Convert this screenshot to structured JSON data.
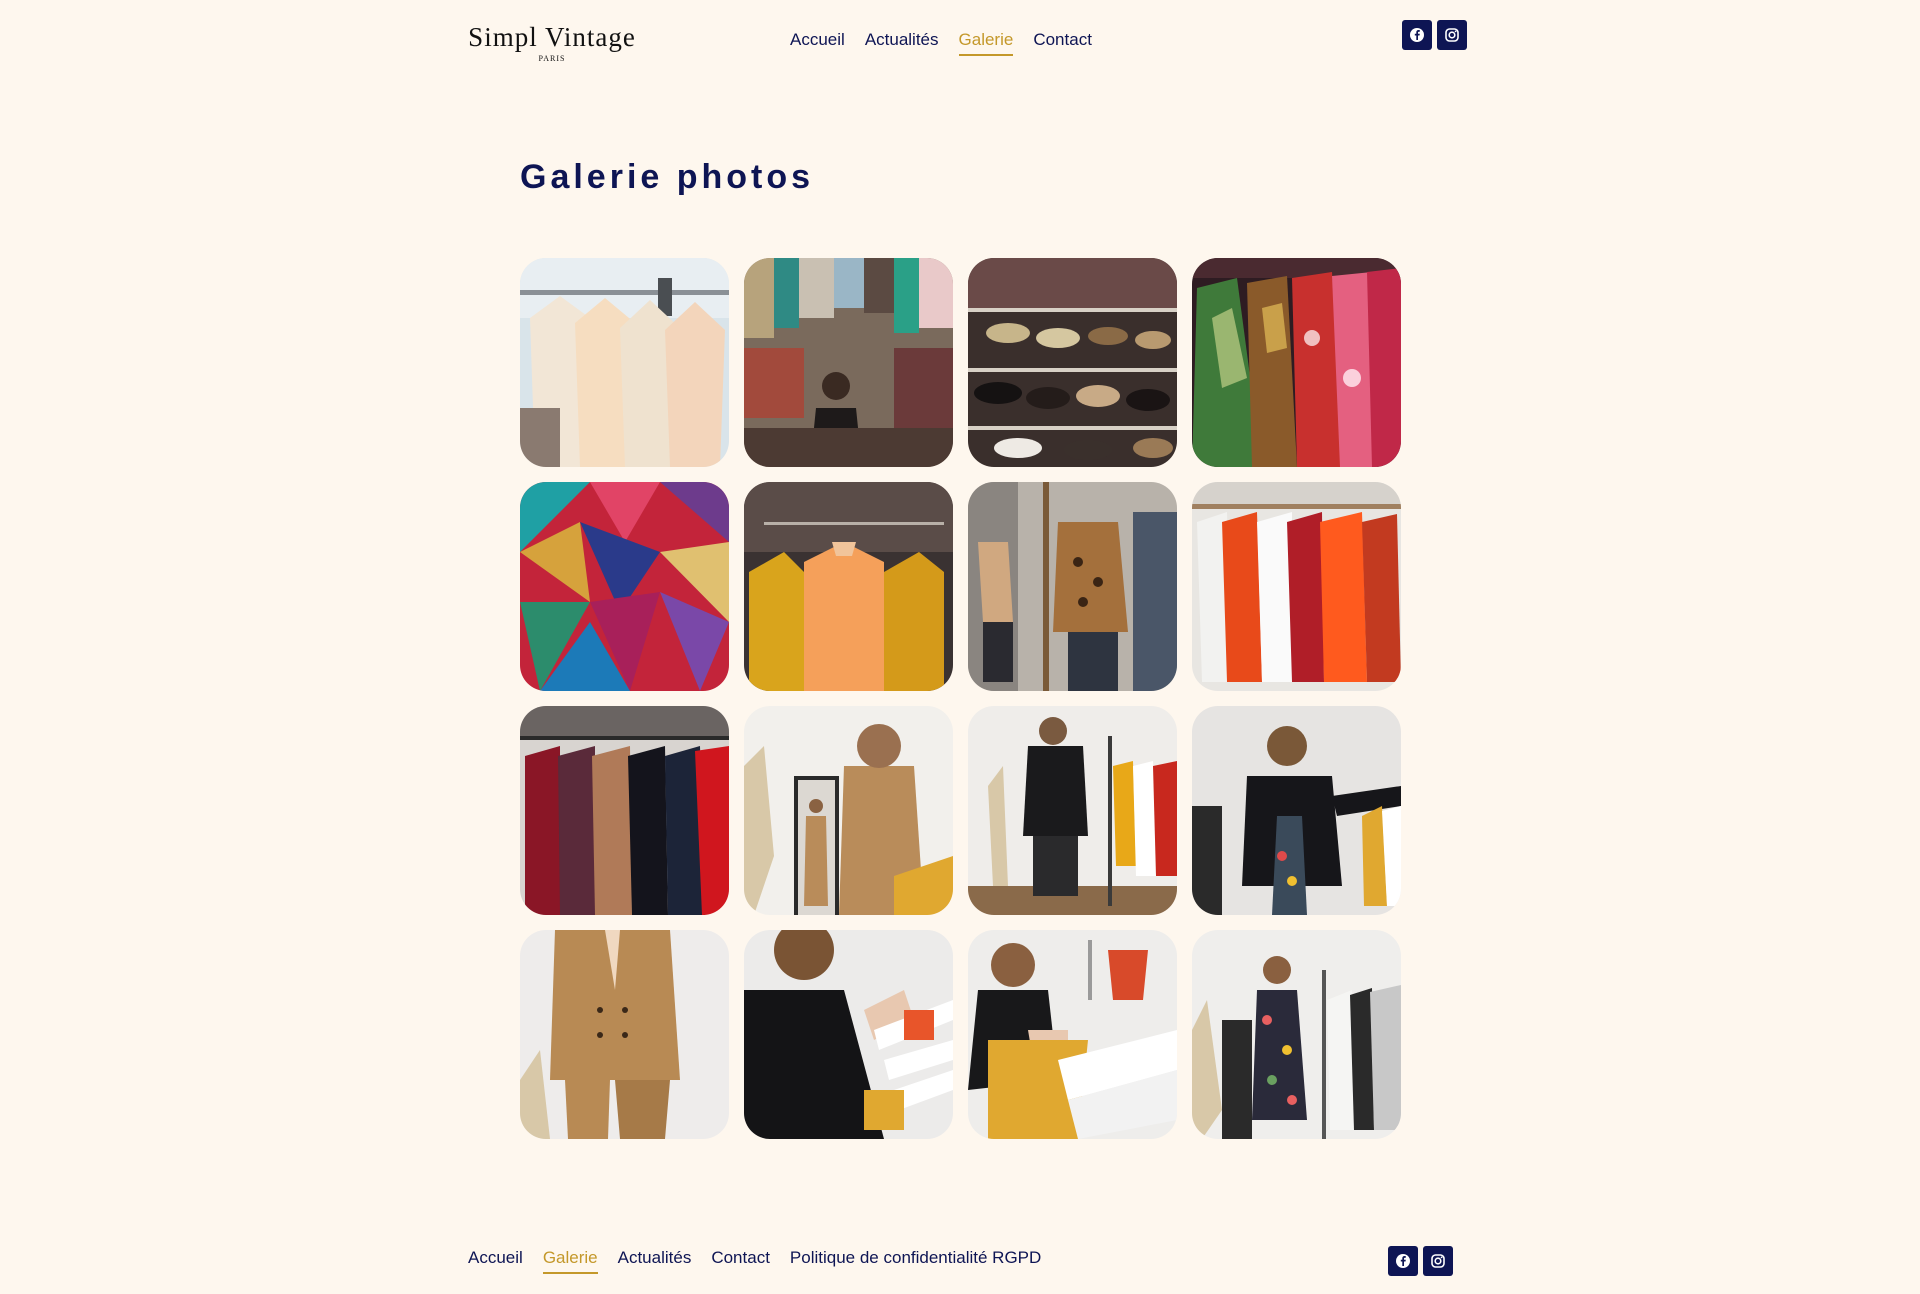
{
  "brand": {
    "name": "Simpl Vintage",
    "tagline": "PARIS"
  },
  "nav": {
    "items": [
      {
        "label": "Accueil",
        "active": false
      },
      {
        "label": "Actualités",
        "active": false
      },
      {
        "label": "Galerie",
        "active": true
      },
      {
        "label": "Contact",
        "active": false
      }
    ]
  },
  "social": {
    "icons": [
      "facebook-icon",
      "instagram-icon"
    ]
  },
  "main": {
    "title": "Galerie photos"
  },
  "gallery": {
    "photos": [
      "rack-of-light-blouses-photo",
      "vintage-shop-interior-photo",
      "shoe-shelves-photo",
      "colorful-printed-shirts-photo",
      "patchwork-fabric-photo",
      "mustard-and-orange-tops-photo",
      "mannequins-in-boutique-photo",
      "red-and-white-shirts-on-rail-photo",
      "winter-coats-on-rack-photo",
      "woman-in-camel-suit-mirror-photo",
      "woman-trying-black-blazer-photo",
      "woman-adjusting-black-blazer-photo",
      "camel-double-breasted-suit-photo",
      "woman-browsing-hangers-photo",
      "woman-choosing-clothes-photo",
      "woman-in-floral-dress-at-rack-photo"
    ]
  },
  "colors": {
    "navy": "#0e1554",
    "gold": "#c4982a",
    "background": "#fef7ee"
  },
  "footer": {
    "links": [
      {
        "label": "Accueil",
        "active": false
      },
      {
        "label": "Galerie",
        "active": true
      },
      {
        "label": "Actualités",
        "active": false
      },
      {
        "label": "Contact",
        "active": false
      },
      {
        "label": "Politique de confidentialité RGPD",
        "active": false
      }
    ]
  }
}
